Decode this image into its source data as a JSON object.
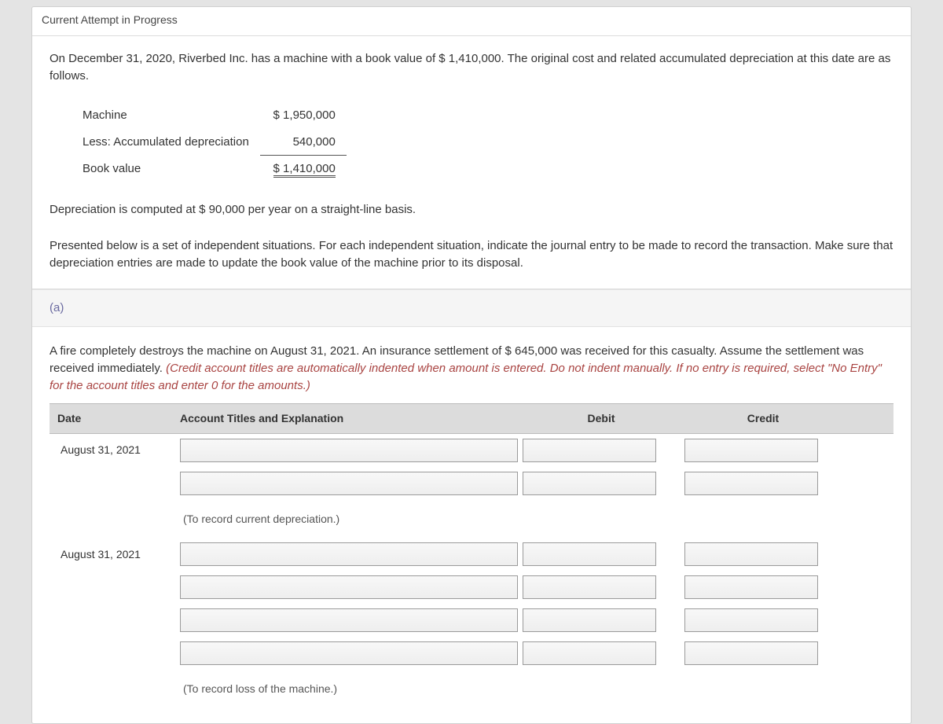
{
  "topbar": "Current Attempt in Progress",
  "intro": "On December 31, 2020, Riverbed Inc. has a machine with a book value of $ 1,410,000. The original cost and related accumulated depreciation at this date are as follows.",
  "book_value_table": {
    "rows": [
      {
        "label": "Machine",
        "amount": "$ 1,950,000"
      },
      {
        "label": "Less: Accumulated depreciation",
        "amount": "540,000"
      },
      {
        "label": "Book value",
        "amount": "$ 1,410,000"
      }
    ]
  },
  "depreciation_note": "Depreciation is computed at $ 90,000 per year on a straight-line basis.",
  "instructions": "Presented below is a set of independent situations. For each independent situation, indicate the journal entry to be made to record the transaction. Make sure that depreciation entries are made to update the book value of the machine prior to its disposal.",
  "section_label": "(a)",
  "scenario_plain": "A fire completely destroys the machine on August 31, 2021. An insurance settlement of $ 645,000 was received for this casualty. Assume the settlement was received immediately. ",
  "scenario_italic": "(Credit account titles are automatically indented when amount is entered. Do not indent manually. If no entry is required, select \"No Entry\" for the account titles and enter 0 for the amounts.)",
  "journal": {
    "headers": {
      "date": "Date",
      "account": "Account Titles and Explanation",
      "debit": "Debit",
      "credit": "Credit"
    },
    "entries": [
      {
        "date": "August 31, 2021",
        "lines": 2,
        "note": "(To record current depreciation.)"
      },
      {
        "date": "August 31, 2021",
        "lines": 4,
        "note": "(To record loss of the machine.)"
      }
    ]
  }
}
